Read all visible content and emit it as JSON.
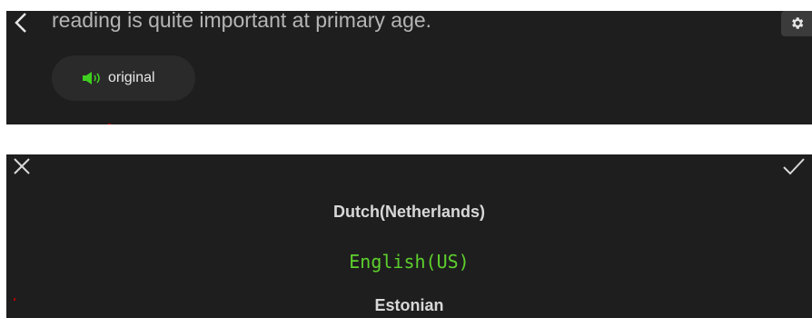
{
  "reader": {
    "sentence": "reading is quite important at primary age.",
    "original_label": "original",
    "icons": {
      "back": "chevron-left-icon",
      "settings": "gear-icon",
      "speaker": "speaker-icon"
    },
    "accent_color": "#3fcf1f"
  },
  "language_picker": {
    "languages": [
      "Dutch(Netherlands)",
      "English(US)",
      "Estonian"
    ],
    "selected": "English(US)",
    "icons": {
      "close": "close-icon",
      "confirm": "check-icon"
    },
    "selected_color": "#5ed02e"
  }
}
